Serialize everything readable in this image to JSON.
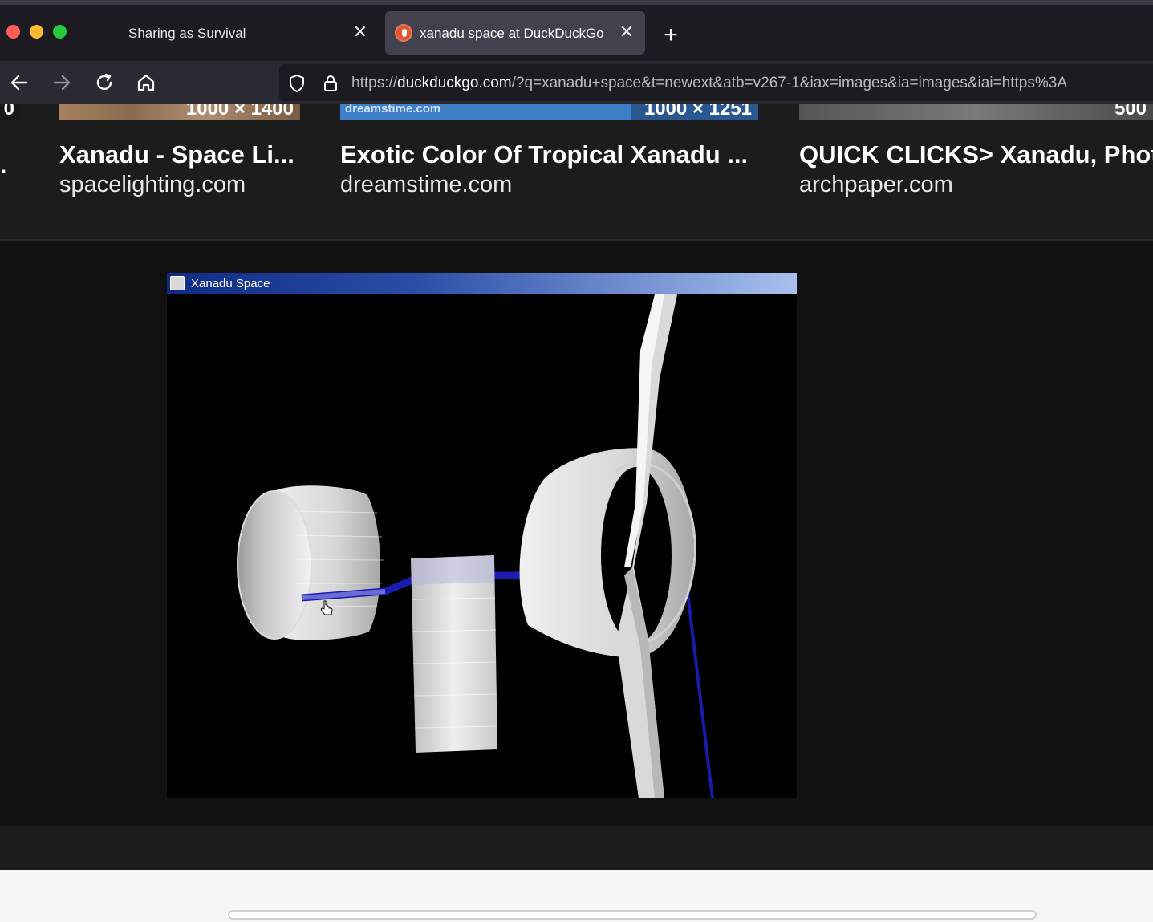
{
  "window": {
    "controls": [
      "close",
      "minimize",
      "maximize"
    ]
  },
  "tabs": [
    {
      "title": "Sharing as Survival",
      "active": false,
      "icon": "none"
    },
    {
      "title": "xanadu space at DuckDuckGo",
      "active": true,
      "icon": "duckduckgo-favicon"
    }
  ],
  "new_tab_label": "+",
  "close_glyph": "✕",
  "nav": {
    "icons": [
      "back-arrow-icon",
      "forward-arrow-icon",
      "reload-icon",
      "home-icon"
    ],
    "url_prefix": "https://",
    "url_host": "duckduckgo.com",
    "url_rest": "/?q=xanadu+space&t=newext&atb=v267-1&iax=images&ia=images&iai=https%3A"
  },
  "results": [
    {
      "size": "0"
    },
    {
      "title": "Xanadu - Space Li...",
      "domain": "spacelighting.com",
      "size": "1000 × 1400"
    },
    {
      "title": "Exotic Color Of Tropical Xanadu ...",
      "domain": "dreamstime.com",
      "size": "1000 × 1251",
      "thumb_source": "dreamstime.com"
    },
    {
      "title": "QUICK CLICKS> Xanadu, Phot",
      "domain": "archpaper.com",
      "size": "500"
    }
  ],
  "edge_text": ".",
  "preview": {
    "window_title": "Xanadu Space",
    "colors": {
      "link_blue": "#1a1aa8",
      "panel_white": "#e6e6e6",
      "background": "#000000"
    }
  }
}
